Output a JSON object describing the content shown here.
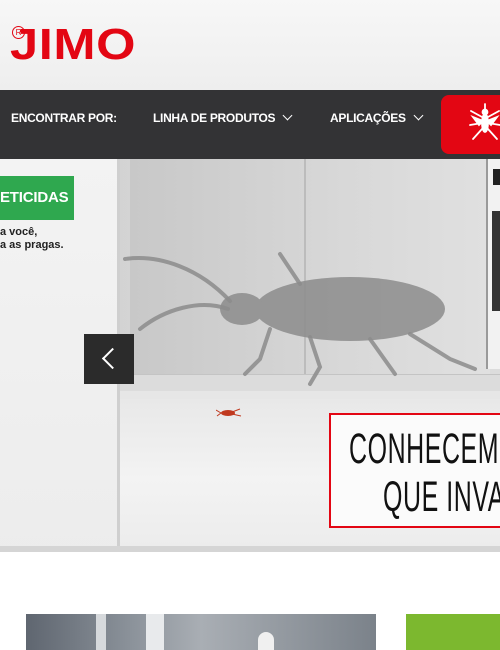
{
  "brand": {
    "logo_text": "JIMO",
    "registered_mark": "R",
    "color": "#e30613"
  },
  "nav": {
    "find_by": "ENCONTRAR POR:",
    "products": "LINHA DE PRODUTOS",
    "applications": "APLICAÇÕES",
    "insect_button_icon": "mosquito-icon",
    "background": "#333335"
  },
  "hero": {
    "promo_badge": "ETICIDAS",
    "promo_line1": "a você,",
    "promo_line2": "a as pragas.",
    "claim_line1": "CONHECEMO",
    "claim_line2": "QUE INVA",
    "prev_icon": "chevron-left-icon",
    "accent_green": "#2fa84f"
  }
}
